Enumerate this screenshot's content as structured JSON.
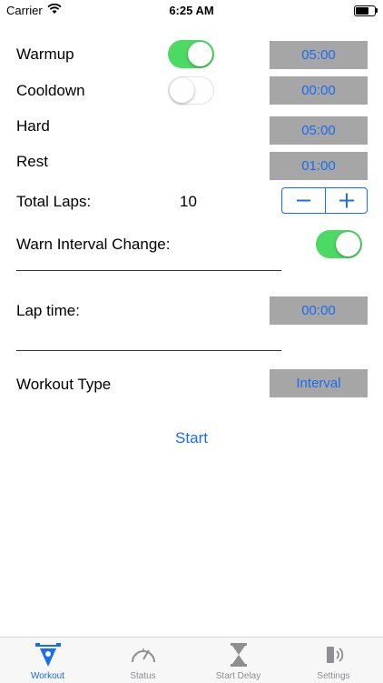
{
  "status_bar": {
    "carrier": "Carrier",
    "time": "6:25 AM"
  },
  "form": {
    "warmup": {
      "label": "Warmup",
      "toggle_on": true,
      "value": "05:00"
    },
    "cooldown": {
      "label": "Cooldown",
      "toggle_on": false,
      "value": "00:00"
    },
    "hard": {
      "label": "Hard",
      "value": "05:00"
    },
    "rest": {
      "label": "Rest",
      "value": "01:00"
    },
    "total_laps": {
      "label": "Total Laps:",
      "value": "10"
    },
    "warn_interval": {
      "label": "Warn Interval Change:",
      "toggle_on": true
    },
    "lap_time": {
      "label": "Lap time:",
      "value": "00:00"
    },
    "workout_type": {
      "label": "Workout Type",
      "value": "Interval"
    }
  },
  "start_label": "Start",
  "tabs": [
    {
      "label": "Workout",
      "icon": "workout-icon",
      "active": true
    },
    {
      "label": "Status",
      "icon": "speedometer-icon",
      "active": false
    },
    {
      "label": "Start Delay",
      "icon": "hourglass-icon",
      "active": false
    },
    {
      "label": "Settings",
      "icon": "sound-settings-icon",
      "active": false
    }
  ],
  "colors": {
    "accent": "#1a6cf0",
    "toggle_on": "#4cd964",
    "value_button_bg": "#a6a6a6"
  }
}
